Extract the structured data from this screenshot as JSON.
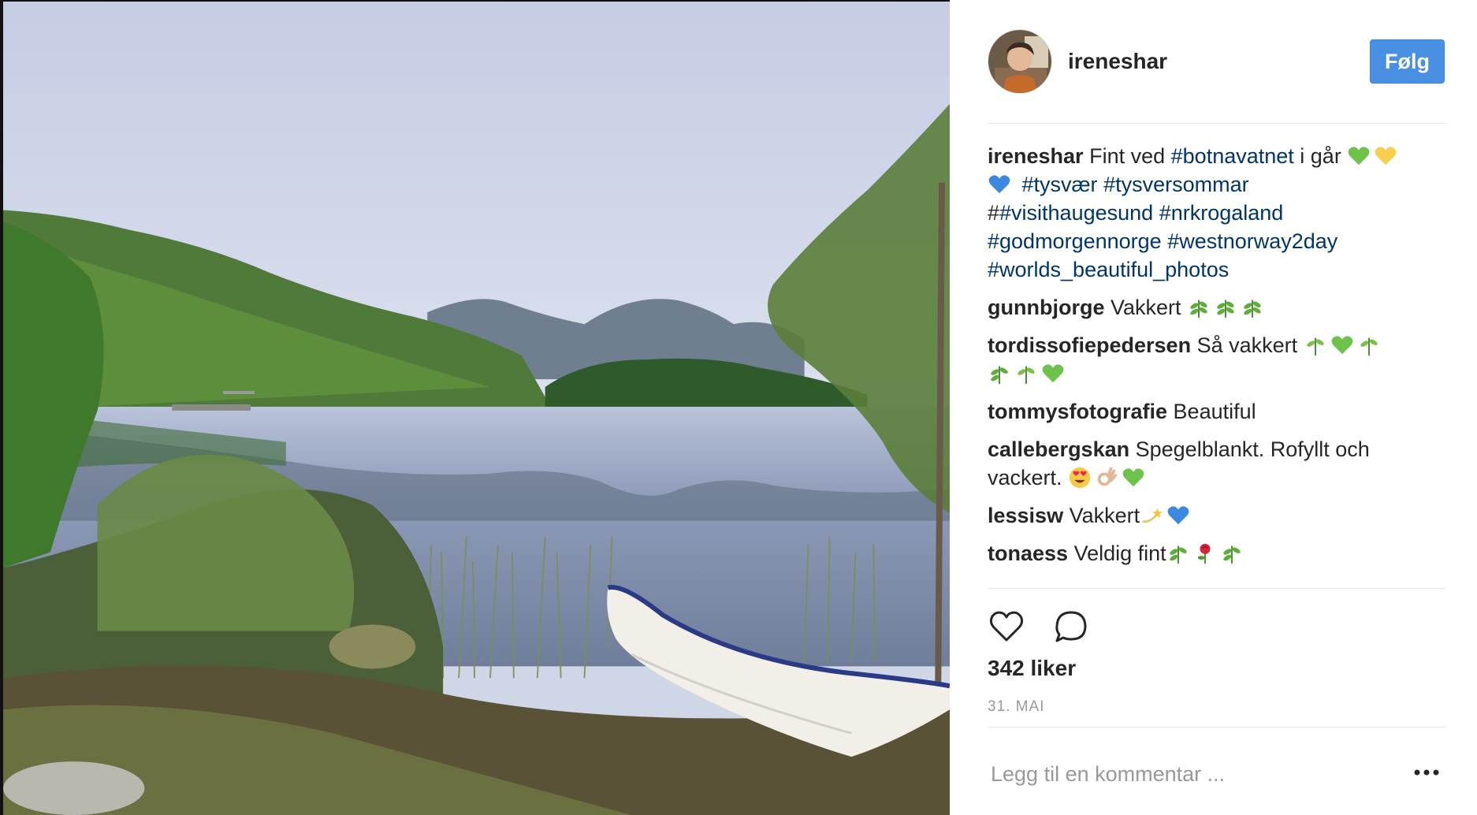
{
  "post": {
    "username": "ireneshar",
    "follow_label": "Følg",
    "caption": {
      "username": "ireneshar",
      "text_1": "Fint ved ",
      "tag_1": "#botnavatnet",
      "text_2": " i går",
      "tag_2": "#tysvær",
      "tag_3": "#tysversommar",
      "prefix_hash": "#",
      "tag_4": "#visithaugesund",
      "tag_5": "#nrkrogaland",
      "tag_6": "#godmorgennorge",
      "tag_7": "#westnorway2day",
      "tag_8": "#worlds_beautiful_photos"
    },
    "comments": [
      {
        "username": "gunnbjorge",
        "text": "Vakkert"
      },
      {
        "username": "tordissofiepedersen",
        "text": "Så vakkert"
      },
      {
        "username": "tommysfotografie",
        "text": "Beautiful"
      },
      {
        "username": "callebergskan",
        "text": "Spegelblankt. Rofyllt och vackert."
      },
      {
        "username": "lessisw",
        "text": "Vakkert"
      },
      {
        "username": "tonaess",
        "text": "Veldig fint"
      }
    ],
    "likes": "342 liker",
    "date": "31. MAI",
    "comment_placeholder": "Legg til en kommentar ..."
  },
  "colors": {
    "follow_button": "#4a90e2",
    "hashtag": "#003569",
    "secondary_text": "#999999"
  },
  "icons": [
    "heart-icon",
    "comment-icon",
    "more-options-icon",
    "green-heart-emoji",
    "yellow-heart-emoji",
    "blue-heart-emoji",
    "herb-emoji",
    "smiling-face-with-heart-eyes-emoji",
    "ok-hand-emoji",
    "dizzy-emoji",
    "rose-emoji"
  ]
}
